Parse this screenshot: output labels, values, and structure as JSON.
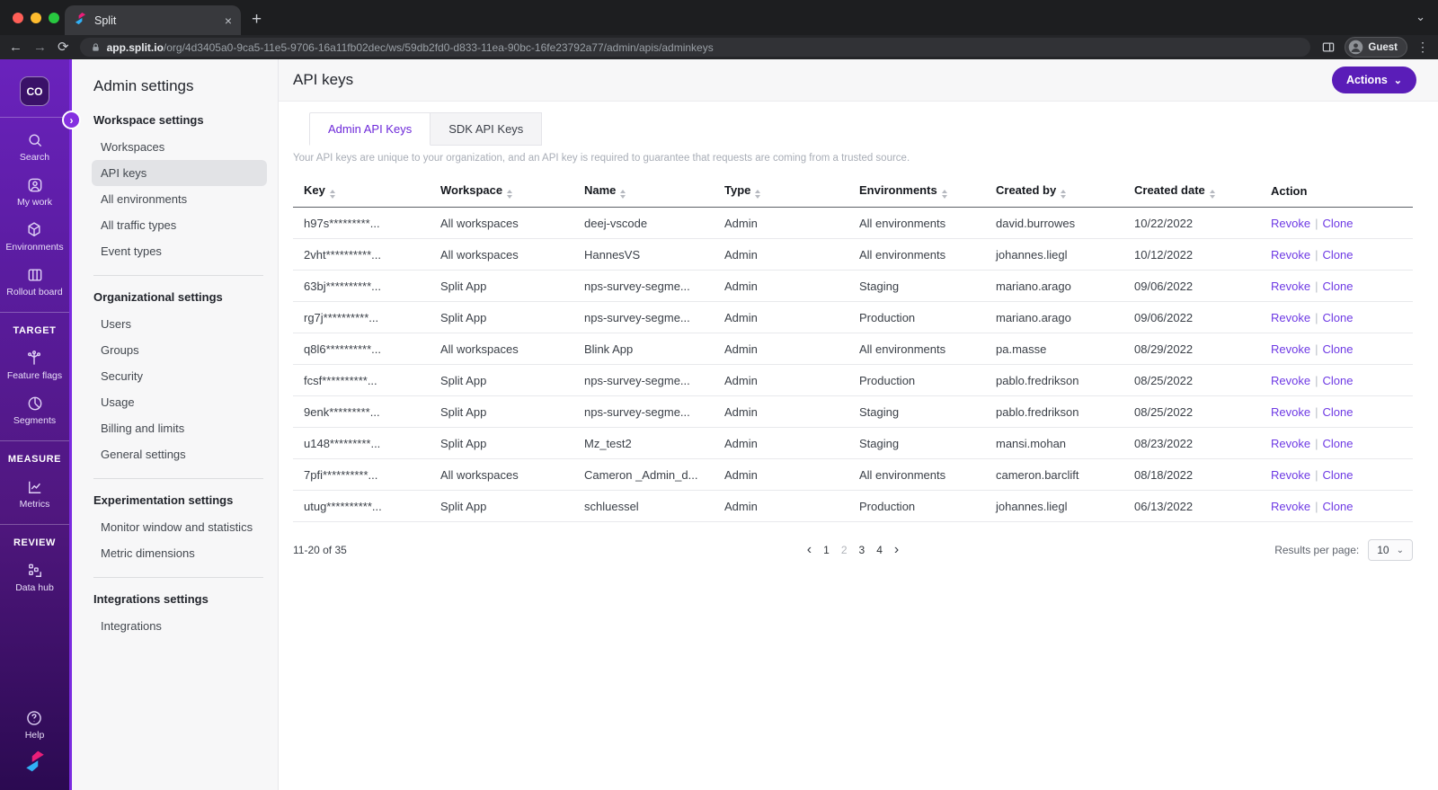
{
  "icons": {
    "close": "×",
    "plus": "+",
    "kebab": "⋮",
    "chevron_down": "⌄",
    "back": "←",
    "forward": "→",
    "reload": "⟳",
    "chevron_left": "‹",
    "chevron_right": "›",
    "expander": "›"
  },
  "colors": {
    "brand_purple": "#5a1db8",
    "rail_purple": "#5a1c9f",
    "link_purple": "#6e3ae4",
    "active_tab_text": "#6d28d9"
  },
  "browser": {
    "tab_title": "Split",
    "url_host": "app.split.io",
    "url_path": "/org/4d3405a0-9ca5-11e5-9706-16a11fb02dec/ws/59db2fd0-d833-11ea-90bc-16fe23792a77/admin/apis/adminkeys",
    "profile": "Guest"
  },
  "rail": {
    "badge": "CO",
    "primary": [
      {
        "icon": "search-icon",
        "label": "Search"
      },
      {
        "icon": "my-work-icon",
        "label": "My work"
      },
      {
        "icon": "environments-icon",
        "label": "Environments"
      },
      {
        "icon": "rollout-board-icon",
        "label": "Rollout board"
      }
    ],
    "sections": [
      {
        "heading": "TARGET",
        "items": [
          {
            "icon": "feature-flags-icon",
            "label": "Feature flags"
          },
          {
            "icon": "segments-icon",
            "label": "Segments"
          }
        ]
      },
      {
        "heading": "MEASURE",
        "items": [
          {
            "icon": "metrics-icon",
            "label": "Metrics"
          }
        ]
      },
      {
        "heading": "REVIEW",
        "items": [
          {
            "icon": "data-hub-icon",
            "label": "Data hub"
          }
        ]
      }
    ],
    "footer": {
      "help_label": "Help"
    }
  },
  "settings_nav": {
    "title": "Admin settings",
    "groups": [
      {
        "heading": "Workspace settings",
        "items": [
          "Workspaces",
          "API keys",
          "All environments",
          "All traffic types",
          "Event types"
        ],
        "selected": "API keys"
      },
      {
        "heading": "Organizational settings",
        "items": [
          "Users",
          "Groups",
          "Security",
          "Usage",
          "Billing and limits",
          "General settings"
        ]
      },
      {
        "heading": "Experimentation settings",
        "items": [
          "Monitor window and statistics",
          "Metric dimensions"
        ]
      },
      {
        "heading": "Integrations settings",
        "items": [
          "Integrations"
        ]
      }
    ]
  },
  "main": {
    "page_title": "API keys",
    "actions_button": "Actions",
    "tabs": [
      {
        "label": "Admin API Keys",
        "active": true
      },
      {
        "label": "SDK API Keys",
        "active": false
      }
    ],
    "description": "Your API keys are unique to your organization, and an API key is required to guarantee that requests are coming from a trusted source.",
    "table": {
      "columns": [
        {
          "label": "Key",
          "sortable": true
        },
        {
          "label": "Workspace",
          "sortable": true
        },
        {
          "label": "Name",
          "sortable": true
        },
        {
          "label": "Type",
          "sortable": true
        },
        {
          "label": "Environments",
          "sortable": true
        },
        {
          "label": "Created by",
          "sortable": true
        },
        {
          "label": "Created date",
          "sortable": true
        },
        {
          "label": "Action",
          "sortable": false
        }
      ],
      "action_labels": {
        "revoke": "Revoke",
        "sep": "|",
        "clone": "Clone"
      },
      "rows": [
        {
          "key": "h97s*********...",
          "workspace": "All workspaces",
          "name": "deej-vscode",
          "type": "Admin",
          "environments": "All environments",
          "created_by": "david.burrowes",
          "created_date": "10/22/2022"
        },
        {
          "key": "2vht**********...",
          "workspace": "All workspaces",
          "name": "HannesVS",
          "type": "Admin",
          "environments": "All environments",
          "created_by": "johannes.liegl",
          "created_date": "10/12/2022"
        },
        {
          "key": "63bj**********...",
          "workspace": "Split App",
          "name": "nps-survey-segme...",
          "type": "Admin",
          "environments": "Staging",
          "created_by": "mariano.arago",
          "created_date": "09/06/2022"
        },
        {
          "key": "rg7j**********...",
          "workspace": "Split App",
          "name": "nps-survey-segme...",
          "type": "Admin",
          "environments": "Production",
          "created_by": "mariano.arago",
          "created_date": "09/06/2022"
        },
        {
          "key": "q8l6**********...",
          "workspace": "All workspaces",
          "name": "Blink App",
          "type": "Admin",
          "environments": "All environments",
          "created_by": "pa.masse",
          "created_date": "08/29/2022"
        },
        {
          "key": "fcsf**********...",
          "workspace": "Split App",
          "name": "nps-survey-segme...",
          "type": "Admin",
          "environments": "Production",
          "created_by": "pablo.fredrikson",
          "created_date": "08/25/2022"
        },
        {
          "key": "9enk*********...",
          "workspace": "Split App",
          "name": "nps-survey-segme...",
          "type": "Admin",
          "environments": "Staging",
          "created_by": "pablo.fredrikson",
          "created_date": "08/25/2022"
        },
        {
          "key": "u148*********...",
          "workspace": "Split App",
          "name": "Mz_test2",
          "type": "Admin",
          "environments": "Staging",
          "created_by": "mansi.mohan",
          "created_date": "08/23/2022"
        },
        {
          "key": "7pfi**********...",
          "workspace": "All workspaces",
          "name": "Cameron _Admin_d...",
          "type": "Admin",
          "environments": "All environments",
          "created_by": "cameron.barclift",
          "created_date": "08/18/2022"
        },
        {
          "key": "utug**********...",
          "workspace": "Split App",
          "name": "schluessel",
          "type": "Admin",
          "environments": "Production",
          "created_by": "johannes.liegl",
          "created_date": "06/13/2022"
        }
      ]
    },
    "pagination": {
      "range_text": "11-20 of 35",
      "pages": [
        "1",
        "2",
        "3",
        "4"
      ],
      "current_page": "2",
      "results_per_page_label": "Results per page:",
      "results_per_page_value": "10"
    }
  }
}
